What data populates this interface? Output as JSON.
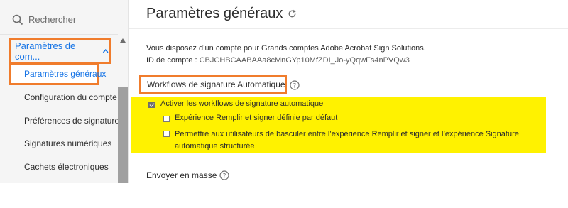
{
  "sidebar": {
    "search_placeholder": "Rechercher",
    "group_label": "Paramètres de com...",
    "items": [
      {
        "label": "Paramètres généraux",
        "active": true
      },
      {
        "label": "Configuration du compte"
      },
      {
        "label": "Préférences de signature"
      },
      {
        "label": "Signatures numériques"
      },
      {
        "label": "Cachets électroniques"
      }
    ]
  },
  "main": {
    "title": "Paramètres généraux",
    "account_text": "Vous disposez d’un compte pour Grands comptes Adobe Acrobat Sign Solutions.",
    "id_label": "ID de compte :",
    "id_value": "CBJCHBCAABAAa8cMnGYp10MfZDI_Jo-yQqwFs4nPVQw3",
    "section_title": "Workflows de signature Automatique",
    "options": {
      "enable": {
        "label": "Activer les workflows de signature automatique",
        "checked": true
      },
      "default_fill_sign": {
        "label": "Expérience Remplir et signer définie par défaut",
        "checked": false
      },
      "allow_switch": {
        "label": "Permettre aux utilisateurs de basculer entre l’expérience Remplir et signer et l’expérience Signature automatique structurée",
        "checked": false
      }
    },
    "next_section": "Envoyer en masse"
  },
  "colors": {
    "accent_blue": "#1473e6",
    "highlight_orange": "#f07c2c",
    "highlight_yellow": "#fff200"
  },
  "icons": [
    "search-icon",
    "chevron-up-icon",
    "refresh-icon",
    "help-icon",
    "scroll-up-arrow-icon"
  ]
}
